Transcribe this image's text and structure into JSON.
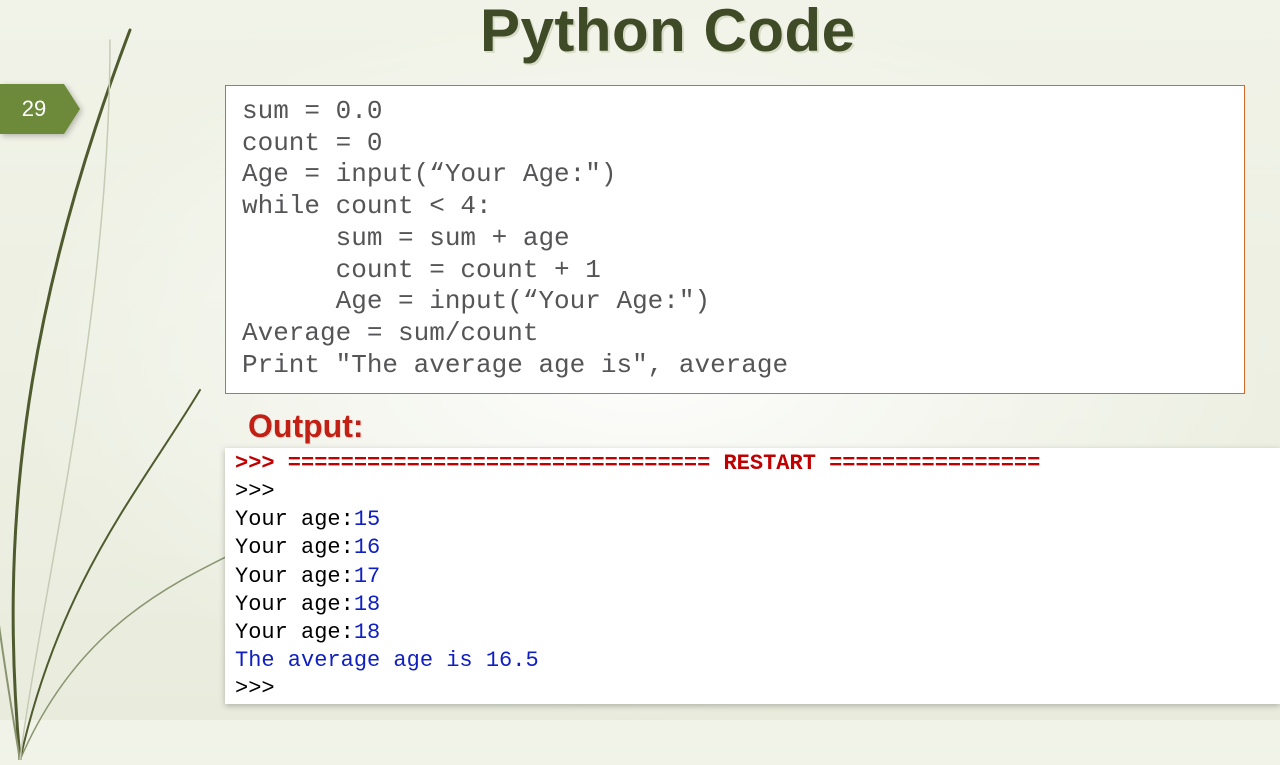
{
  "slide_number": "29",
  "title": "Python Code",
  "code": {
    "l1": "sum = 0.0",
    "l2": "count = 0",
    "l3": "Age = input(“Your Age:\")",
    "l4": "while count < 4:",
    "l5": "      sum = sum + age",
    "l6": "      count = count + 1",
    "l7": "      Age = input(“Your Age:\")",
    "l8": "Average = sum/count",
    "l9": "Print \"The average age is\", average"
  },
  "output_label": "Output:",
  "console": {
    "restart": ">>> ================================ RESTART ================",
    "p1": ">>> ",
    "r1_a": "Your age:",
    "r1_b": "15",
    "r2_a": "Your age:",
    "r2_b": "16",
    "r3_a": "Your age:",
    "r3_b": "17",
    "r4_a": "Your age:",
    "r4_b": "18",
    "r5_a": "Your age:",
    "r5_b": "18",
    "final": "The average age is 16.5",
    "p2": ">>> "
  }
}
